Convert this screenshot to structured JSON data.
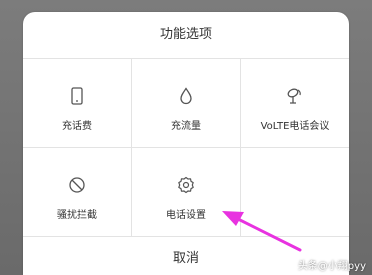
{
  "dialog": {
    "title": "功能选项",
    "cancel_label": "取消",
    "options": [
      {
        "label": "充话费",
        "icon": "phone-device-icon"
      },
      {
        "label": "充流量",
        "icon": "water-drop-icon"
      },
      {
        "label": "VoLTE电话会议",
        "icon": "satellite-dish-icon"
      },
      {
        "label": "骚扰拦截",
        "icon": "block-icon"
      },
      {
        "label": "电话设置",
        "icon": "gear-icon"
      }
    ]
  },
  "annotation": {
    "color": "#e832e0"
  },
  "watermark": "头条@小翔pyy"
}
